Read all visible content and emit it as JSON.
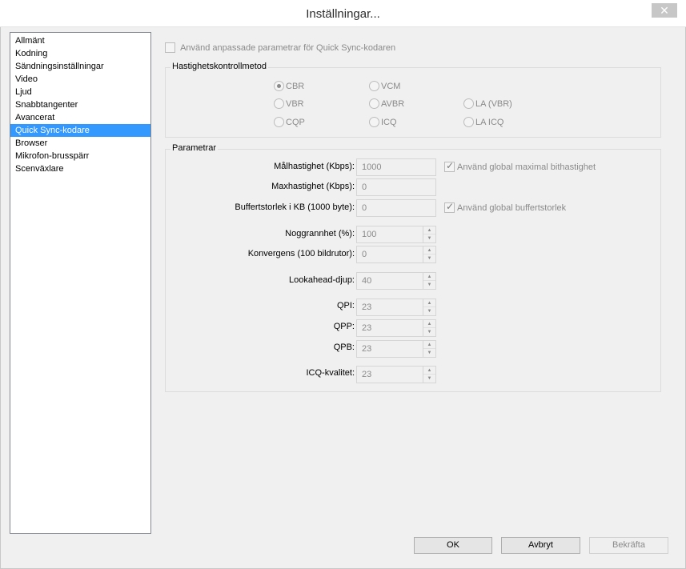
{
  "window": {
    "title": "Inställningar...",
    "close_glyph": "✕"
  },
  "sidebar": {
    "items": [
      {
        "label": "Allmänt"
      },
      {
        "label": "Kodning"
      },
      {
        "label": "Sändningsinställningar"
      },
      {
        "label": "Video"
      },
      {
        "label": "Ljud"
      },
      {
        "label": "Snabbtangenter"
      },
      {
        "label": "Avancerat"
      },
      {
        "label": "Quick Sync-kodare"
      },
      {
        "label": "Browser"
      },
      {
        "label": "Mikrofon-brusspärr"
      },
      {
        "label": "Scenväxlare"
      }
    ],
    "selected_index": 7
  },
  "top_checkbox": {
    "label": "Använd anpassade parametrar för Quick Sync-kodaren",
    "checked": false
  },
  "rate_control": {
    "title": "Hastighetskontrollmetod",
    "options": [
      {
        "label": "CBR",
        "checked": true
      },
      {
        "label": "VCM",
        "checked": false
      },
      {
        "label": "VBR",
        "checked": false
      },
      {
        "label": "AVBR",
        "checked": false
      },
      {
        "label": "LA (VBR)",
        "checked": false
      },
      {
        "label": "CQP",
        "checked": false
      },
      {
        "label": "ICQ",
        "checked": false
      },
      {
        "label": "LA ICQ",
        "checked": false
      }
    ]
  },
  "params": {
    "title": "Parametrar",
    "target_bitrate": {
      "label": "Målhastighet (Kbps):",
      "value": "1000"
    },
    "max_bitrate": {
      "label": "Maxhastighet (Kbps):",
      "value": "0"
    },
    "buffer_size": {
      "label": "Buffertstorlek i KB (1000 byte):",
      "value": "0"
    },
    "global_max_bitrate": {
      "label": "Använd global maximal bithastighet",
      "checked": true
    },
    "global_buffer": {
      "label": "Använd global buffertstorlek",
      "checked": true
    },
    "accuracy": {
      "label": "Noggrannhet (%):",
      "value": "100"
    },
    "convergence": {
      "label": "Konvergens (100 bildrutor):",
      "value": "0"
    },
    "lookahead": {
      "label": "Lookahead-djup:",
      "value": "40"
    },
    "qpi": {
      "label": "QPI:",
      "value": "23"
    },
    "qpp": {
      "label": "QPP:",
      "value": "23"
    },
    "qpb": {
      "label": "QPB:",
      "value": "23"
    },
    "icq_quality": {
      "label": "ICQ-kvalitet:",
      "value": "23"
    }
  },
  "buttons": {
    "ok": "OK",
    "cancel": "Avbryt",
    "apply": "Bekräfta"
  }
}
